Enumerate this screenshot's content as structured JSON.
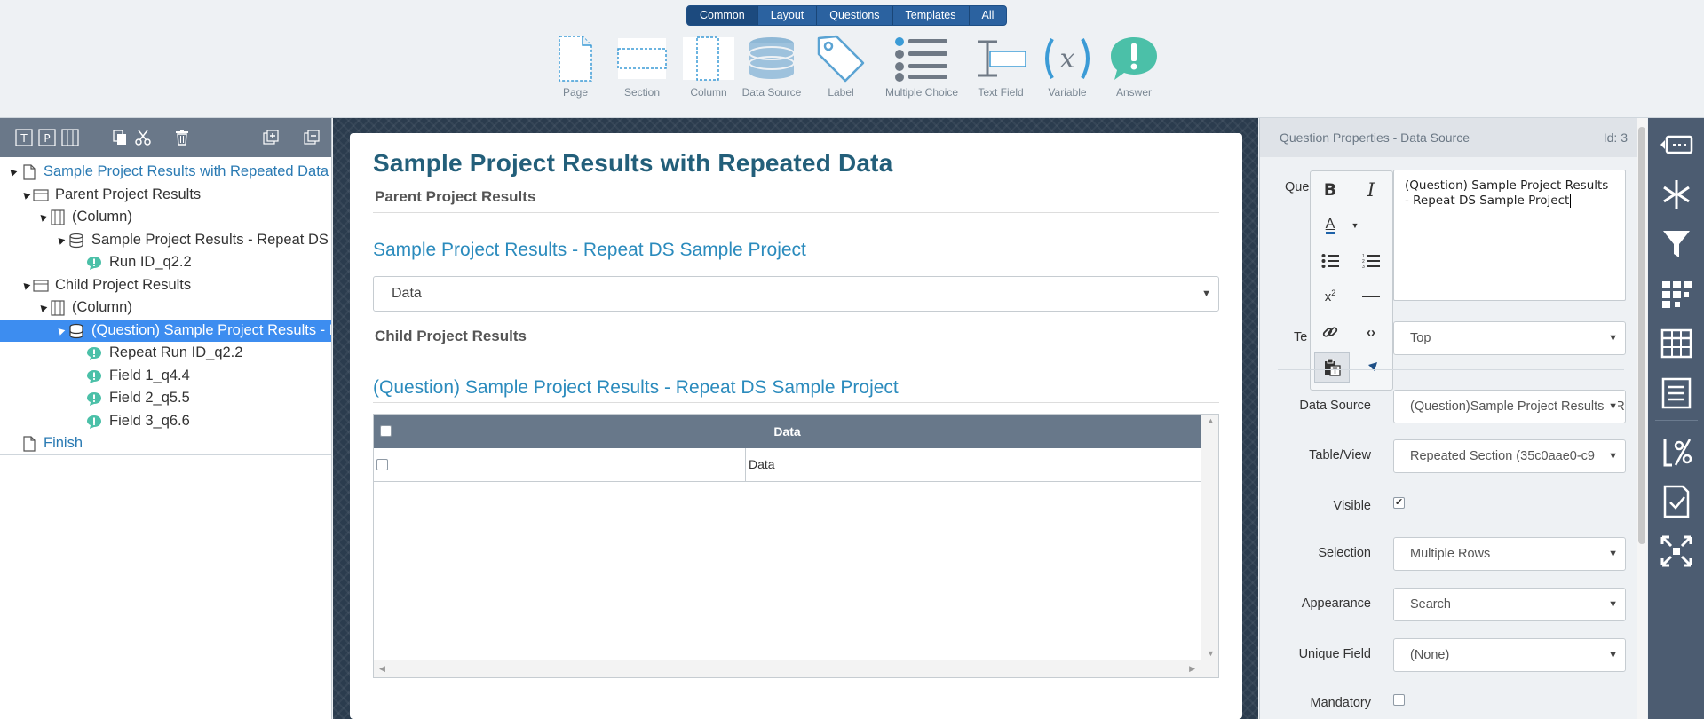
{
  "toolbar": {
    "tabs": [
      {
        "label": "Common",
        "active": true
      },
      {
        "label": "Layout",
        "active": false
      },
      {
        "label": "Questions",
        "active": false
      },
      {
        "label": "Templates",
        "active": false
      },
      {
        "label": "All",
        "active": false
      }
    ],
    "tools": [
      {
        "label": "Page",
        "icon": "page-icon"
      },
      {
        "label": "Section",
        "icon": "section-icon"
      },
      {
        "label": "Column",
        "icon": "column-icon"
      },
      {
        "label": "Data Source",
        "icon": "database-icon"
      },
      {
        "label": "Label",
        "icon": "tag-icon"
      },
      {
        "label": "Multiple Choice",
        "icon": "list-icon"
      },
      {
        "label": "Text Field",
        "icon": "text-cursor-icon"
      },
      {
        "label": "Variable",
        "icon": "variable-icon"
      },
      {
        "label": "Answer",
        "icon": "answer-icon"
      }
    ]
  },
  "tree": {
    "nodes": [
      {
        "label": "Sample Project Results with Repeated Data",
        "icon": "page-icon",
        "level": 0
      },
      {
        "label": "Parent Project Results",
        "icon": "section-icon",
        "level": 1
      },
      {
        "label": "(Column)",
        "icon": "column-icon",
        "level": 2
      },
      {
        "label": "Sample Project Results - Repeat DS Sample Project",
        "icon": "database-icon",
        "level": 3
      },
      {
        "label": "Run ID_q2.2",
        "icon": "answer-icon",
        "level": 4
      },
      {
        "label": "Child Project Results",
        "icon": "section-icon",
        "level": 1
      },
      {
        "label": "(Column)",
        "icon": "column-icon",
        "level": 2
      },
      {
        "label": "(Question) Sample Project Results - Repeat DS Sample Project",
        "icon": "database-icon",
        "level": 3
      },
      {
        "label": "Repeat Run ID_q2.2",
        "icon": "answer-icon",
        "level": 4
      },
      {
        "label": "Field 1_q4.4",
        "icon": "answer-icon",
        "level": 4
      },
      {
        "label": "Field 2_q5.5",
        "icon": "answer-icon",
        "level": 4
      },
      {
        "label": "Field 3_q6.6",
        "icon": "answer-icon",
        "level": 4
      },
      {
        "label": "Finish",
        "icon": "page-icon",
        "level": 0
      }
    ]
  },
  "canvas": {
    "page_title": "Sample Project Results with Repeated Data",
    "section1_title": "Parent Project Results",
    "question1_title": "Sample Project Results - Repeat DS Sample Project",
    "question1_value": "Data",
    "section2_title": "Child Project Results",
    "question2_title": "(Question) Sample Project Results - Repeat DS Sample Project",
    "grid_header": "Data",
    "grid_row_value": "Data"
  },
  "properties": {
    "header_title": "Question Properties - Data Source",
    "header_id": "Id: 3",
    "question_label": "Que",
    "question_text": "(Question) Sample Project Results - Repeat DS Sample Project",
    "text_position_label": "Te",
    "text_position_value": "Top",
    "data_source_label": "Data Source",
    "data_source_value": "(Question)Sample Project Results - Repeat DS Sample Project",
    "table_view_label": "Table/View",
    "table_view_value": "Repeated Section (35c0aae0-c9",
    "visible_label": "Visible",
    "selection_label": "Selection",
    "selection_value": "Multiple Rows",
    "appearance_label": "Appearance",
    "appearance_value": "Search",
    "unique_field_label": "Unique Field",
    "unique_field_value": "(None)",
    "mandatory_label": "Mandatory"
  }
}
